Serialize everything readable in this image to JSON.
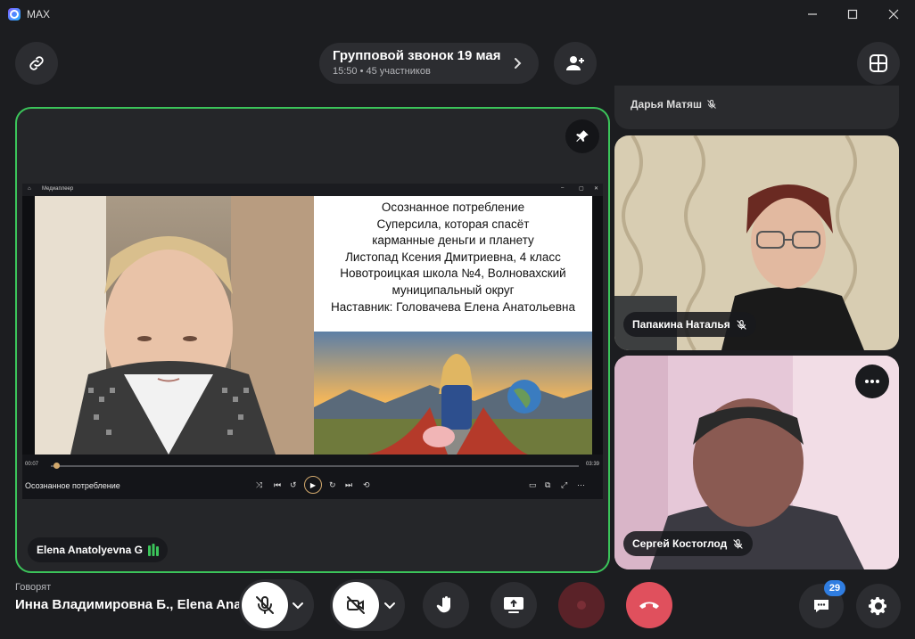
{
  "app": {
    "title": "MAX"
  },
  "header": {
    "call_title": "Групповой звонок 19 мая",
    "call_time": "15:50",
    "call_participants": "45 участников"
  },
  "main_tile": {
    "name": "Elena Anatolyevna G",
    "shared_screen": {
      "window_title": "Медиаплеер",
      "slide_lines": [
        "Осознанное потребление",
        "Суперсила, которая спасёт",
        "карманные деньги и планету",
        "Листопад Ксения Дмитриевна, 4 класс",
        "Новотроицкая школа №4, Волновахский",
        "муниципальный округ",
        "Наставник: Головачева Елена Анатольевна"
      ],
      "track_title": "Осознанное потребление",
      "time_current": "00:07",
      "time_total": "03:39",
      "progress": 0.01
    }
  },
  "side_tiles": [
    {
      "name": "Дарья Матяш",
      "muted": true
    },
    {
      "name": "Папакина Наталья",
      "muted": true
    },
    {
      "name": "Сергей Костоглод",
      "muted": true
    }
  ],
  "bottom": {
    "speaking_label": "Говорят",
    "speaking_names": "Инна Владимировна Б., Elena Ana...",
    "chat_badge": "29"
  },
  "colors": {
    "accent_green": "#3bc45a",
    "end_call": "#e0505d",
    "badge_blue": "#2f7de1"
  }
}
